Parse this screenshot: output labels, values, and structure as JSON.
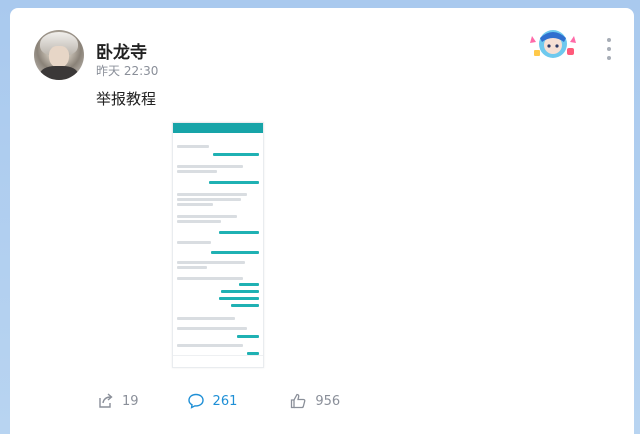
{
  "post": {
    "author": "卧龙寺",
    "time": "昨天 22:30",
    "text": "举报教程"
  },
  "actions": {
    "share_count": "19",
    "comment_count": "261",
    "like_count": "956"
  },
  "colors": {
    "accent": "#1e8fd6",
    "muted": "#8a8f99",
    "screenshot_teal": "#17a4a8"
  },
  "icons": [
    "share-icon",
    "comment-icon",
    "like-icon",
    "more-icon"
  ]
}
